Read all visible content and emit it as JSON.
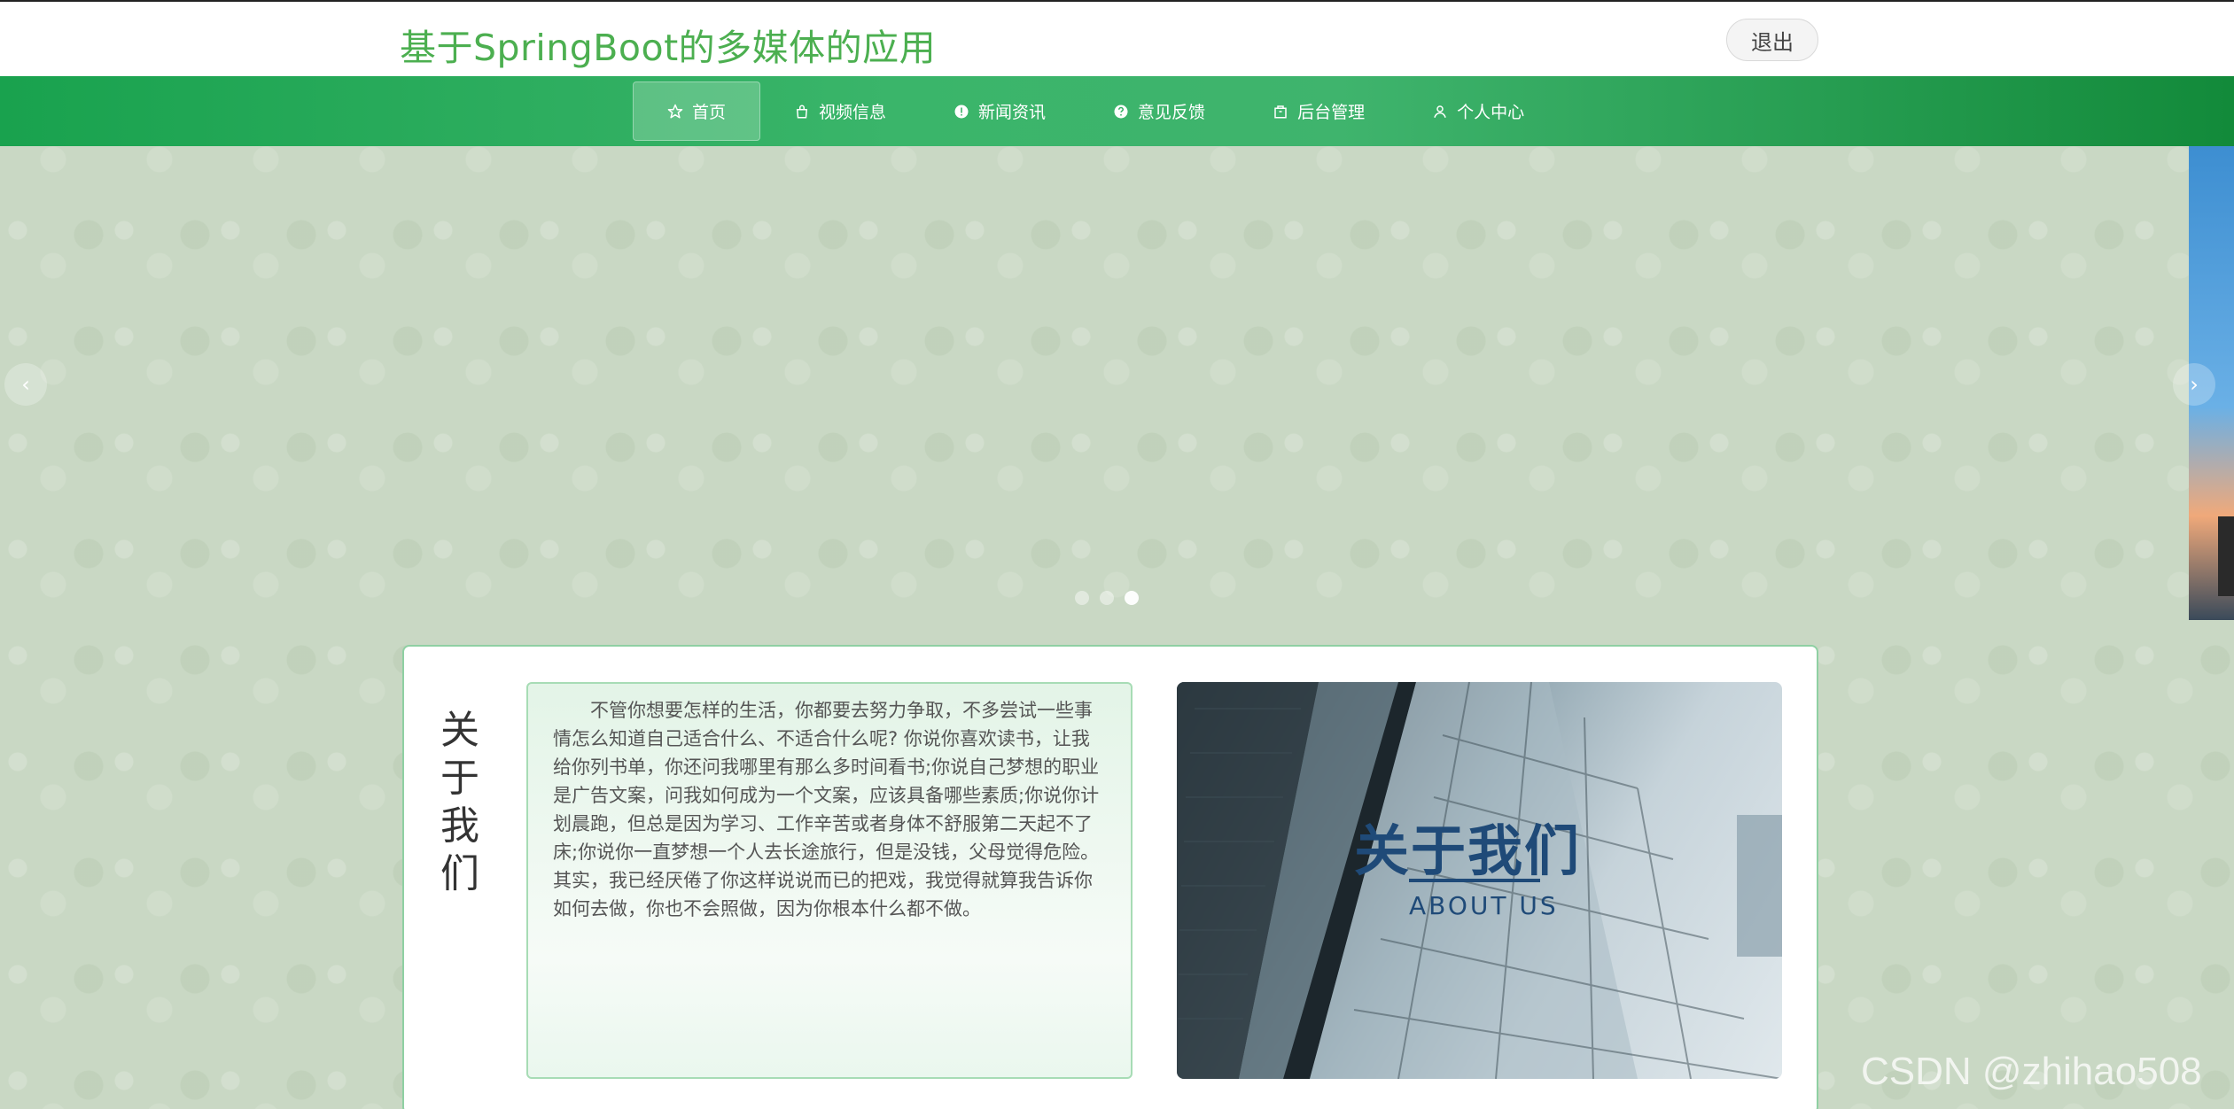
{
  "header": {
    "title": "基于SpringBoot的多媒体的应用",
    "logout_label": "退出"
  },
  "nav": {
    "items": [
      {
        "label": "首页",
        "icon": "star-icon"
      },
      {
        "label": "视频信息",
        "icon": "bag-icon"
      },
      {
        "label": "新闻资讯",
        "icon": "info-icon"
      },
      {
        "label": "意见反馈",
        "icon": "question-icon"
      },
      {
        "label": "后台管理",
        "icon": "box-icon"
      },
      {
        "label": "个人中心",
        "icon": "user-icon"
      }
    ],
    "active_index": 0
  },
  "carousel": {
    "prev_label": "‹",
    "next_label": "›",
    "dot_count": 3,
    "active_dot": 2
  },
  "about": {
    "vertical_title": [
      "关",
      "于",
      "我",
      "们"
    ],
    "paragraph": "不管你想要怎样的生活，你都要去努力争取，不多尝试一些事情怎么知道自己适合什么、不适合什么呢? 你说你喜欢读书，让我给你列书单，你还问我哪里有那么多时间看书;你说自己梦想的职业是广告文案，问我如何成为一个文案，应该具备哪些素质;你说你计划晨跑，但总是因为学习、工作辛苦或者身体不舒服第二天起不了床;你说你一直梦想一个人去长途旅行，但是没钱，父母觉得危险。其实，我已经厌倦了你这样说说而已的把戏，我觉得就算我告诉你如何去做，你也不会照做，因为你根本什么都不做。",
    "image_title": "关于我们",
    "image_subtitle": "ABOUT US"
  },
  "watermark": "CSDN @zhihao508",
  "colors": {
    "title_green": "#4caf50",
    "nav_green": "#3ab56a",
    "panel_border": "#8fd0a3",
    "about_blue": "#1f4a78"
  }
}
